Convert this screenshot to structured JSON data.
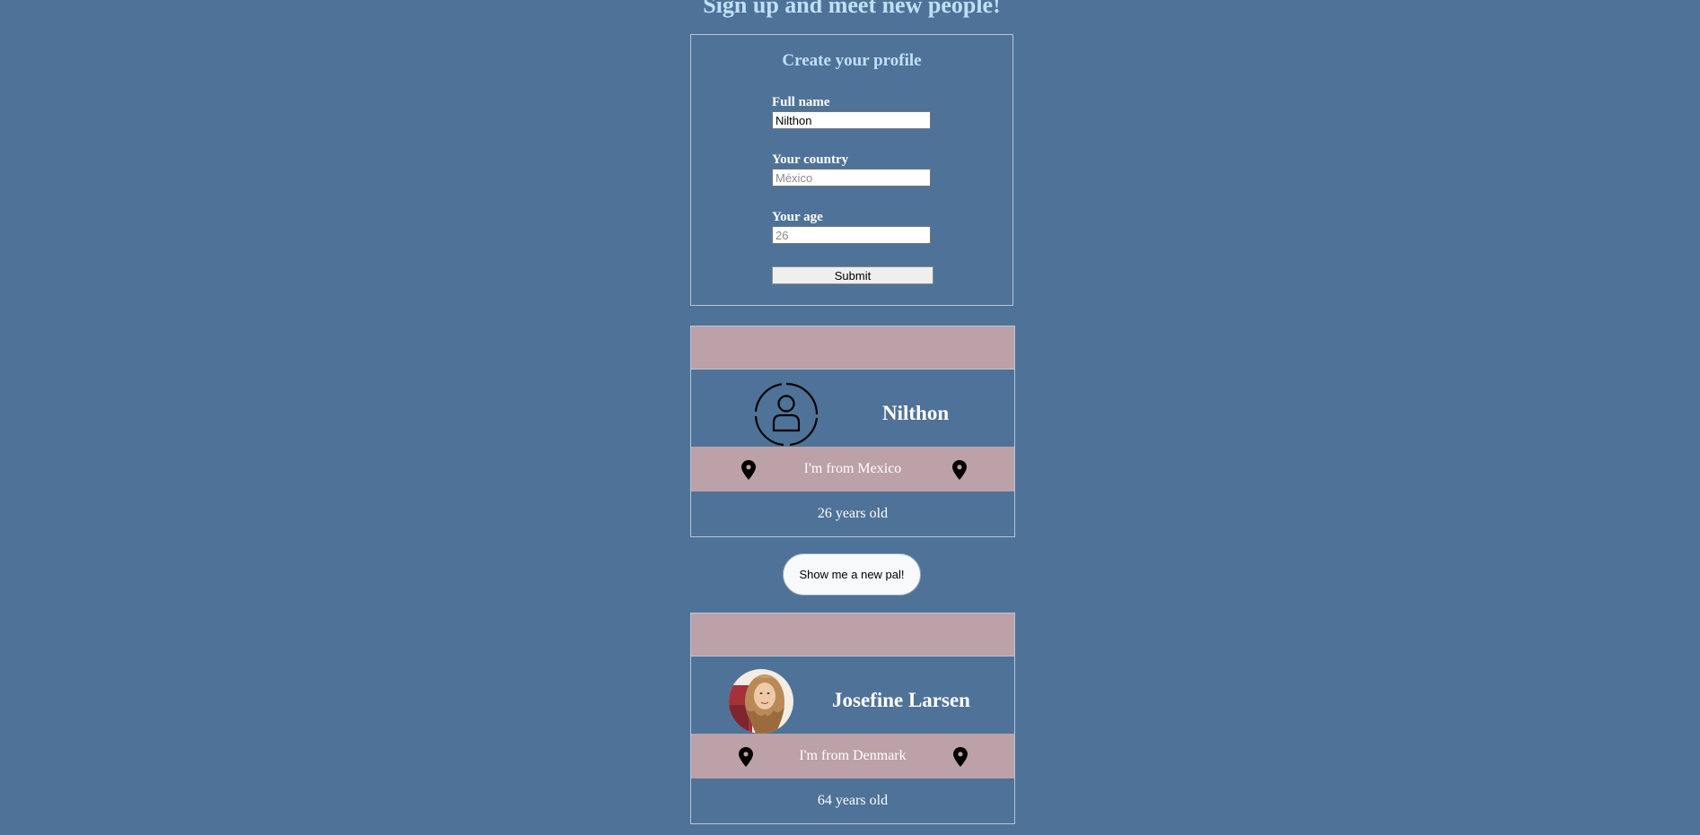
{
  "page": {
    "title": "Sign up and meet new people!"
  },
  "form": {
    "heading": "Create your profile",
    "name_label": "Full name",
    "name_value": "Nilthon",
    "country_label": "Your country",
    "country_placeholder": "México",
    "age_label": "Your age",
    "age_placeholder": "26",
    "submit_label": "Submit"
  },
  "my_profile": {
    "avatar_icon": "user-circle-icon",
    "name": "Nilthon",
    "location": "I'm from Mexico",
    "age": "26 years old"
  },
  "new_pal_button": "Show me a new pal!",
  "pal_profile": {
    "avatar": "profile-photo",
    "name": "Josefine Larsen",
    "location": "I'm from Denmark",
    "age": "64 years old"
  },
  "colors": {
    "background": "#4f7298",
    "accent_band": "#bca1a8",
    "heading": "#bfe0f7",
    "border": "#b9c6d4"
  }
}
